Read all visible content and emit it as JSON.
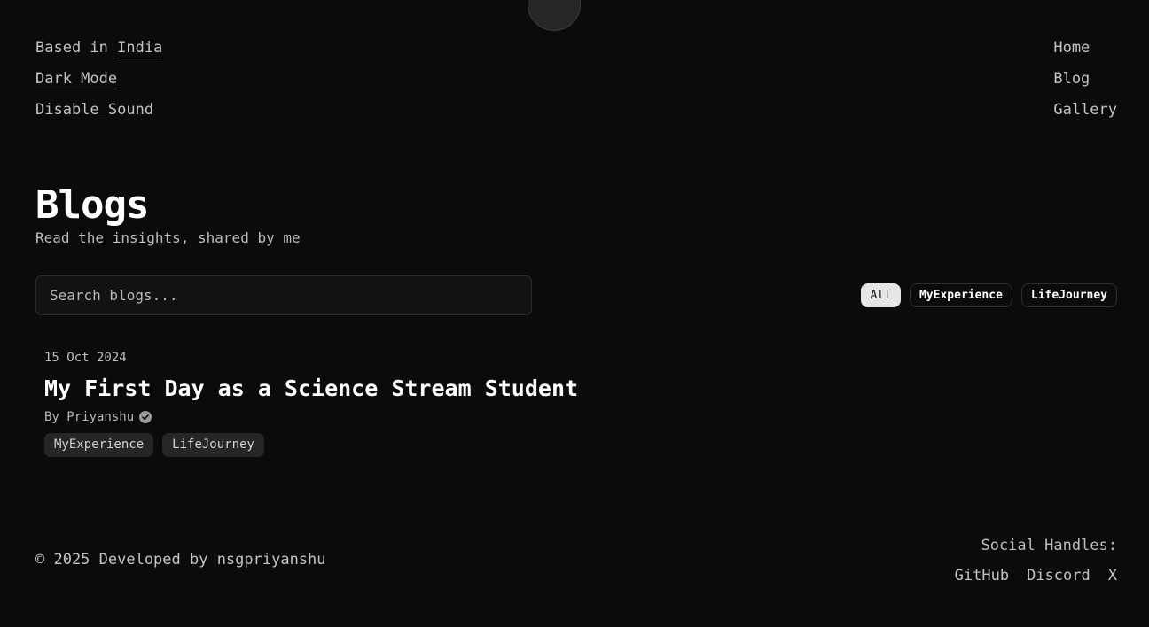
{
  "header": {
    "left": {
      "location_prefix": "Based in ",
      "location": "India",
      "dark_mode": "Dark Mode",
      "sound": "Disable Sound"
    },
    "nav": [
      "Home",
      "Blog",
      "Gallery"
    ]
  },
  "main": {
    "title": "Blogs",
    "subtitle": "Read the insights, shared by me",
    "search": {
      "placeholder": "Search blogs...",
      "value": ""
    },
    "filters": [
      {
        "label": "All",
        "active": true
      },
      {
        "label": "MyExperience",
        "active": false
      },
      {
        "label": "LifeJourney",
        "active": false
      }
    ],
    "posts": [
      {
        "date": "15 Oct 2024",
        "title": "My First Day as a Science Stream Student",
        "author": "By Priyanshu",
        "verified_icon": "verified-badge-icon",
        "tags": [
          "MyExperience",
          "LifeJourney"
        ]
      }
    ]
  },
  "footer": {
    "copyright": "© 2025 Developed by nsgpriyanshu",
    "social_title": "Social Handles:",
    "social_links": [
      "GitHub",
      "Discord",
      "X"
    ]
  },
  "colors": {
    "background": "#0b0b0b",
    "text": "#c4c4c4",
    "heading": "#ffffff",
    "chip_active_bg": "#e6e6e6",
    "tag_bg": "#262626"
  }
}
